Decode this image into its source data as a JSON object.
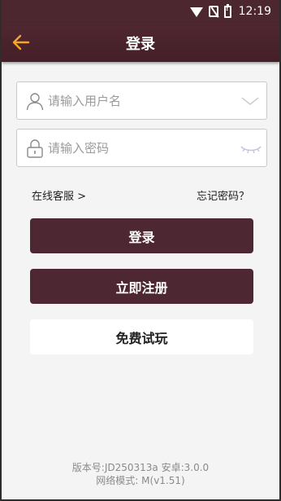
{
  "status_bar": {
    "time": "12:19",
    "icons": [
      "wifi-icon",
      "no-sim-icon",
      "battery-alert-icon"
    ]
  },
  "header": {
    "title": "登录",
    "back_icon": "back-arrow-icon"
  },
  "form": {
    "username": {
      "placeholder": "请输入用户名",
      "value": ""
    },
    "password": {
      "placeholder": "请输入密码",
      "value": ""
    }
  },
  "links": {
    "support": "在线客服 >",
    "forgot": "忘记密码？"
  },
  "buttons": {
    "login": "登录",
    "register": "立即注册",
    "trial": "免费试玩"
  },
  "footer": {
    "version": "版本号:JD250313a 安卓:3.0.0",
    "network": "网络模式: M(v1.51)"
  },
  "colors": {
    "brand": "#4d2731",
    "accent": "#f5a623",
    "background": "#f4f4f4"
  }
}
